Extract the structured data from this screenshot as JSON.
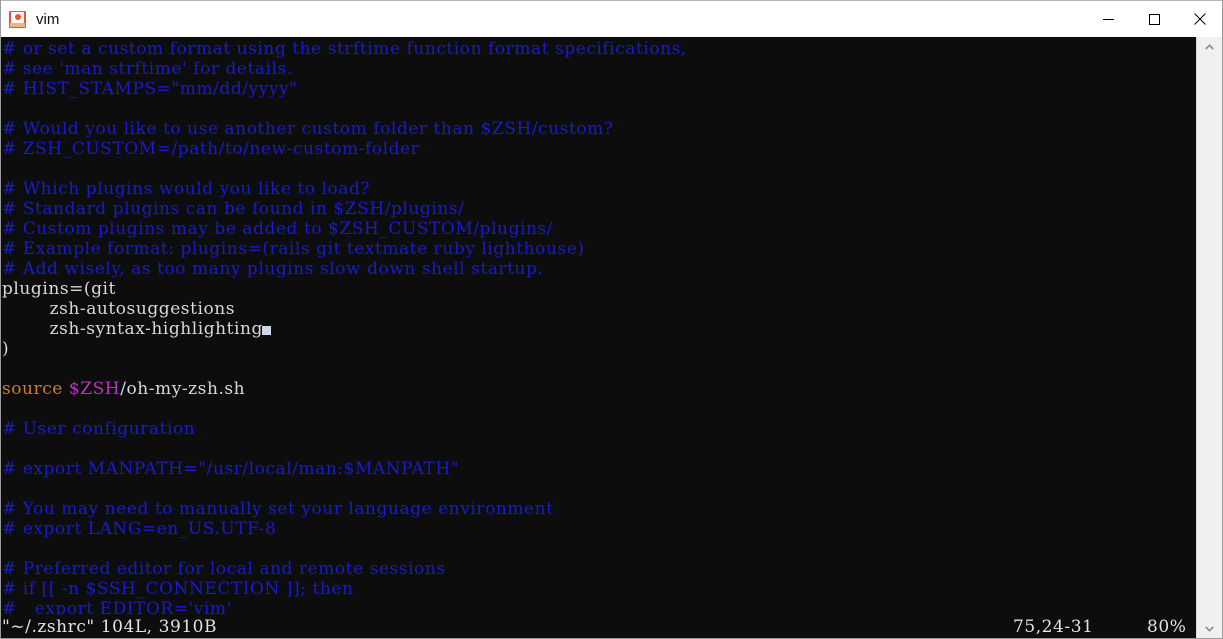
{
  "window": {
    "title": "vim",
    "app_icon": "vim-icon",
    "controls": {
      "minimize": "minimize-button",
      "maximize": "maximize-button",
      "close": "close-button"
    }
  },
  "editor": {
    "lines": [
      [
        {
          "t": "# or set a custom format using the strftime function format specifications,",
          "c": "cmt"
        }
      ],
      [
        {
          "t": "# see 'man strftime' for details.",
          "c": "cmt"
        }
      ],
      [
        {
          "t": "# HIST_STAMPS=\"mm/dd/yyyy\"",
          "c": "cmt"
        }
      ],
      [],
      [
        {
          "t": "# Would you like to use another custom folder than $ZSH/custom?",
          "c": "cmt"
        }
      ],
      [
        {
          "t": "# ZSH_CUSTOM=/path/to/new-custom-folder",
          "c": "cmt"
        }
      ],
      [],
      [
        {
          "t": "# Which plugins would you like to load?",
          "c": "cmt"
        }
      ],
      [
        {
          "t": "# Standard plugins can be found in $ZSH/plugins/",
          "c": "cmt"
        }
      ],
      [
        {
          "t": "# Custom plugins may be added to $ZSH_CUSTOM/plugins/",
          "c": "cmt"
        }
      ],
      [
        {
          "t": "# Example format: plugins=(rails git textmate ruby lighthouse)",
          "c": "cmt"
        }
      ],
      [
        {
          "t": "# Add wisely, as too many plugins slow down shell startup.",
          "c": "cmt"
        }
      ],
      [
        {
          "t": "plugins=(git",
          "c": "plain"
        }
      ],
      [
        {
          "t": "        zsh-autosuggestions",
          "c": "plain"
        }
      ],
      [
        {
          "t": "        zsh-syntax-highlighting",
          "c": "plain",
          "cursor": true
        }
      ],
      [
        {
          "t": ")",
          "c": "plain"
        }
      ],
      [],
      [
        {
          "t": "source ",
          "c": "kw"
        },
        {
          "t": "$ZSH",
          "c": "var"
        },
        {
          "t": "/oh-my-zsh.sh",
          "c": "plain"
        }
      ],
      [],
      [
        {
          "t": "# User configuration",
          "c": "cmt"
        }
      ],
      [],
      [
        {
          "t": "# export MANPATH=\"/usr/local/man:$MANPATH\"",
          "c": "cmt"
        }
      ],
      [],
      [
        {
          "t": "# You may need to manually set your language environment",
          "c": "cmt"
        }
      ],
      [
        {
          "t": "# export LANG=en_US.UTF-8",
          "c": "cmt"
        }
      ],
      [],
      [
        {
          "t": "# Preferred editor for local and remote sessions",
          "c": "cmt"
        }
      ],
      [
        {
          "t": "# if [[ -n $SSH_CONNECTION ]]; then",
          "c": "cmt"
        }
      ],
      [
        {
          "t": "#   export EDITOR='vim'",
          "c": "cmt"
        }
      ]
    ],
    "status": {
      "file": "\"~/.zshrc\" 104L, 3910B",
      "position": "75,24-31",
      "percent": "80%"
    }
  },
  "scrollbar": {
    "up_icon": "chevron-up-icon",
    "down_icon": "chevron-down-icon"
  },
  "colors": {
    "background": "#0d0d0d",
    "comment": "#1a1ad0",
    "normal_text": "#d8d8d8",
    "keyword": "#c87f2a",
    "variable": "#c030c0",
    "titlebar": "#ffffff",
    "accent": "#e8562a"
  }
}
